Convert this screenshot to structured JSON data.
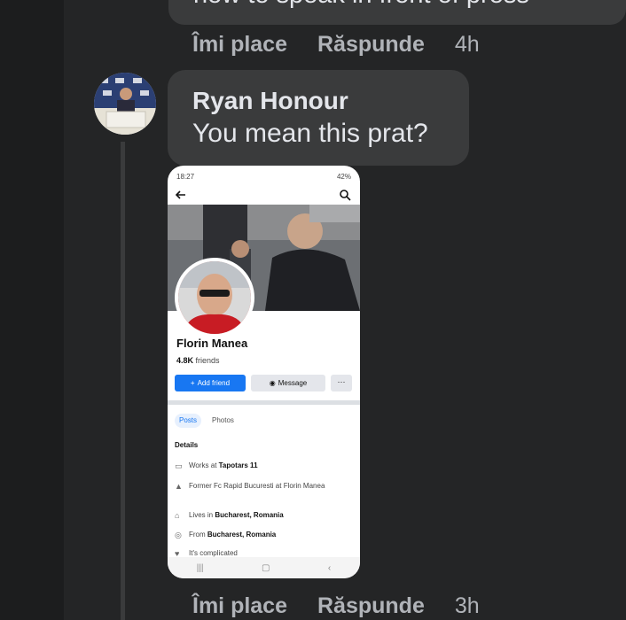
{
  "previous_comment": {
    "text": "how to speak in front of press",
    "actions": {
      "like": "Îmi place",
      "reply": "Răspunde",
      "time": "4h"
    }
  },
  "comment": {
    "author": "Ryan Honour",
    "text": "You mean this prat?",
    "actions": {
      "like": "Îmi place",
      "reply": "Răspunde",
      "time": "3h"
    }
  },
  "screenshot": {
    "status_time": "18:27",
    "status_battery": "42%",
    "profile_name": "Florin Manea",
    "friends_count": "4.8K",
    "friends_label": "friends",
    "add_friend": "Add friend",
    "message": "Message",
    "more": "···",
    "tabs": [
      "Posts",
      "Photos"
    ],
    "details_heading": "Details",
    "details": [
      {
        "icon": "briefcase-icon",
        "prefix": "Works at ",
        "bold": "Tapotars 11"
      },
      {
        "icon": "graduation-icon",
        "prefix": "Former Fc Rapid Bucuresti at Florin Manea",
        "bold": ""
      },
      {
        "icon": "home-icon",
        "prefix": "Lives in ",
        "bold": "Bucharest, Romania"
      },
      {
        "icon": "location-icon",
        "prefix": "From ",
        "bold": "Bucharest, Romania"
      },
      {
        "icon": "heart-icon",
        "prefix": "It's complicated",
        "bold": ""
      }
    ]
  }
}
